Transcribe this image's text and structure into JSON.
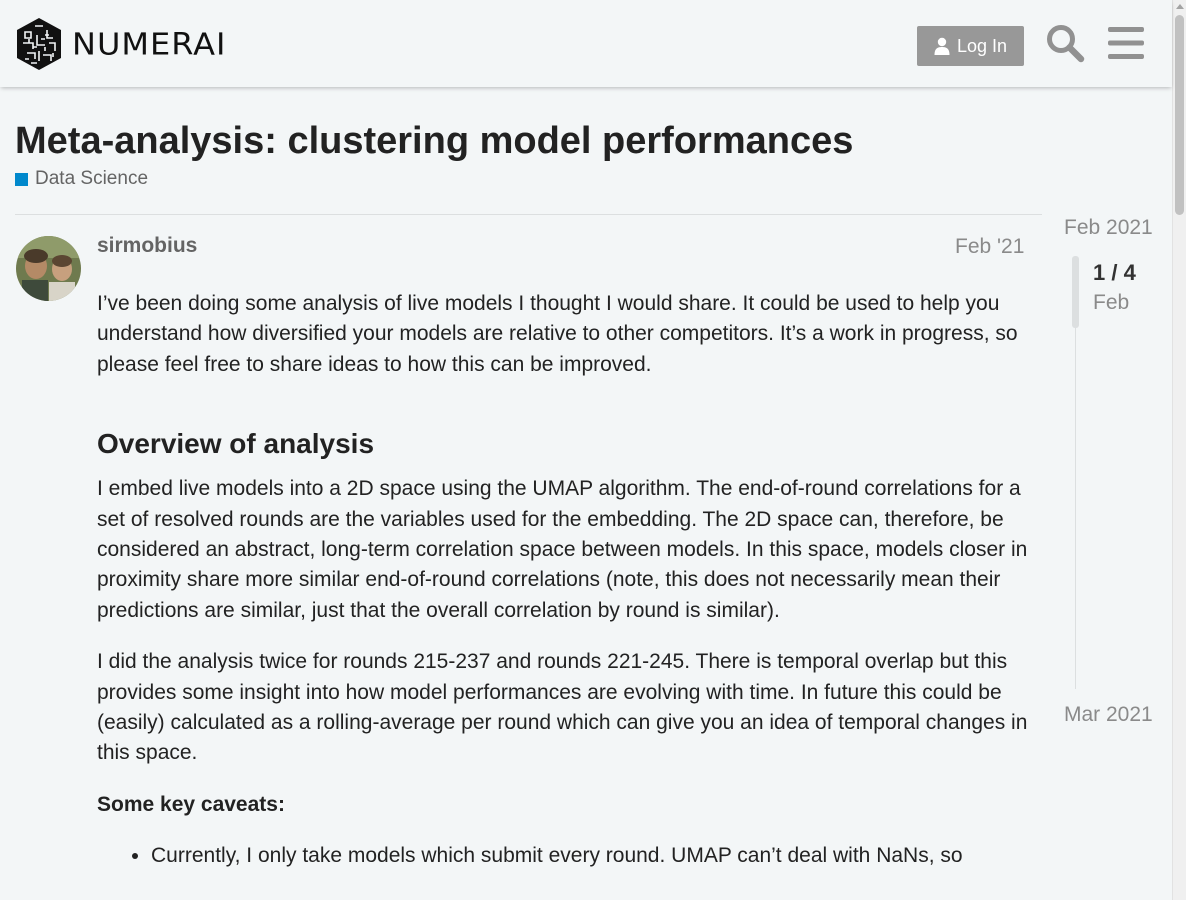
{
  "header": {
    "logo_text": "NUMERAI",
    "login_label": "Log In",
    "search_icon": "search-icon",
    "menu_icon": "hamburger-menu-icon"
  },
  "topic": {
    "title": "Meta-analysis: clustering model performances",
    "category": "Data Science",
    "category_color": "#0088cc"
  },
  "post": {
    "author": "sirmobius",
    "date": "Feb '21",
    "intro": "I’ve been doing some analysis of live models I thought I would share. It could be used to help you understand how diversified your models are relative to other competitors. It’s a work in progress, so please feel free to share ideas to how this can be improved.",
    "heading": "Overview of analysis",
    "para1": "I embed live models into a 2D space using the UMAP algorithm. The end-of-round correlations for a set of resolved rounds are the variables used for the embedding. The 2D space can, therefore, be considered an abstract, long-term correlation space between models. In this space, models closer in proximity share more similar end-of-round correlations (note, this does not necessarily mean their predictions are similar, just that the overall correlation by round is similar).",
    "para2": "I did the analysis twice for rounds 215-237 and rounds 221-245. There is temporal overlap but this provides some insight into how model performances are evolving with time. In future this could be (easily) calculated as a rolling-average per round which can give you an idea of temporal changes in this space.",
    "caveats_heading": "Some key caveats:",
    "caveats": [
      "Currently, I only take models which submit every round. UMAP can’t deal with NaNs, so"
    ]
  },
  "timeline": {
    "start": "Feb 2021",
    "count": "1 / 4",
    "current_month": "Feb",
    "end": "Mar 2021"
  }
}
